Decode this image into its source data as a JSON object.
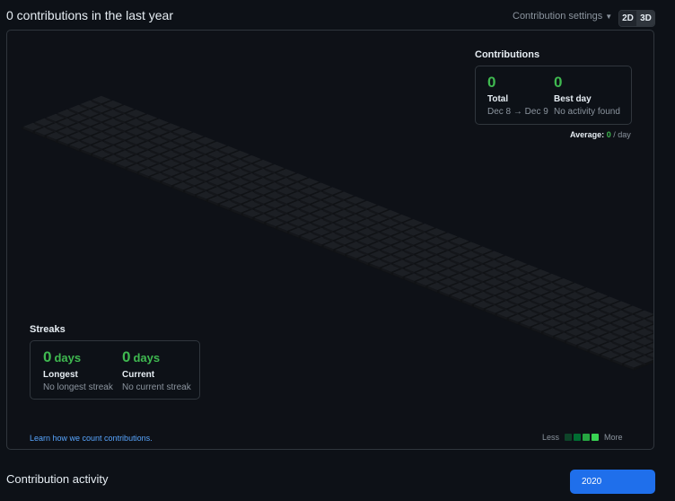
{
  "header": {
    "title": "0 contributions in the last year",
    "settings_label": "Contribution settings",
    "view_2d": "2D",
    "view_3d": "3D"
  },
  "calendar": {
    "cell_color": "#1c1f24",
    "cell_side_color": "#101215",
    "cell_front_color": "#14161a",
    "weeks": 53,
    "days": 7
  },
  "contributions": {
    "title": "Contributions",
    "total_value": "0",
    "total_label": "Total",
    "total_range": "Dec 8 → Dec 9",
    "best_value": "0",
    "best_label": "Best day",
    "best_note": "No activity found",
    "average_label": "Average:",
    "average_value": "0",
    "average_unit": "/ day"
  },
  "streaks": {
    "title": "Streaks",
    "longest_value": "0",
    "longest_unit": "days",
    "longest_label": "Longest",
    "longest_note": "No longest streak",
    "current_value": "0",
    "current_unit": "days",
    "current_label": "Current",
    "current_note": "No current streak"
  },
  "footer": {
    "learn_link": "Learn how we count contributions.",
    "legend_less": "Less",
    "legend_more": "More",
    "legend_colors": [
      "#0e4429",
      "#006d32",
      "#26a641",
      "#39d353"
    ]
  },
  "activity": {
    "title": "Contribution activity",
    "year_button": "2020"
  }
}
